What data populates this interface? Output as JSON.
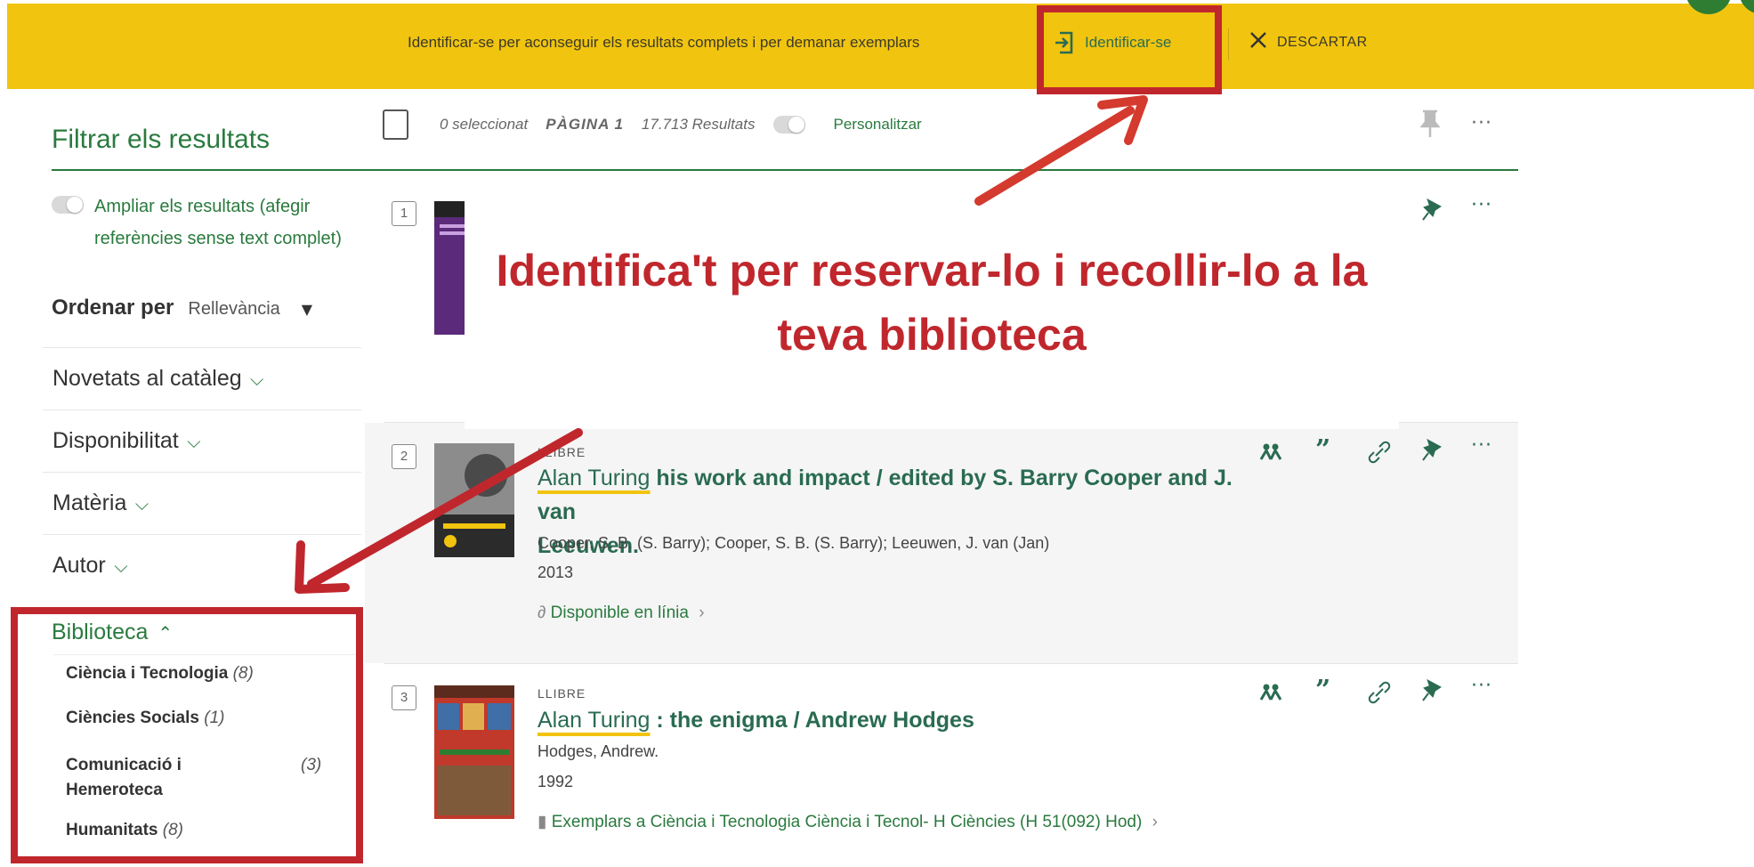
{
  "banner": {
    "message": "Identificar-se per aconseguir els resultats complets i per demanar exemplars",
    "login_label": "Identificar-se",
    "dismiss_label": "DESCARTAR",
    "background_color": "#f1c40f"
  },
  "sidebar": {
    "title": "Filtrar els resultats",
    "expand_label": "Ampliar els resultats (afegir referències sense text complet)",
    "sort_label": "Ordenar per",
    "sort_value": "Rellevància",
    "facets": [
      {
        "label": "Novetats al catàleg",
        "icon": "chevron-down-icon"
      },
      {
        "label": "Disponibilitat",
        "icon": "chevron-down-icon"
      },
      {
        "label": "Matèria",
        "icon": "chevron-down-icon"
      },
      {
        "label": "Autor",
        "icon": "chevron-down-icon"
      }
    ],
    "library": {
      "label": "Biblioteca",
      "icon": "chevron-up-icon",
      "items": [
        {
          "label": "Ciència i Tecnologia",
          "count": "(8)"
        },
        {
          "label": "Ciències Socials",
          "count": "(1)"
        },
        {
          "label": "Comunicació i",
          "label2": "Hemeroteca",
          "count": "(3)"
        },
        {
          "label": "Humanitats",
          "count": "(8)"
        }
      ]
    }
  },
  "results_header": {
    "selected": "0 seleccionat",
    "page": "PÀGINA 1",
    "count": "17.713 Resultats",
    "personalize": "Personalitzar"
  },
  "results": [
    {
      "number": "1"
    },
    {
      "number": "2",
      "type": "LLIBRE",
      "title_highlight": "Alan Turing",
      "title_line1": " his work and impact / edited by S. Barry Cooper and J. van",
      "title_line2": "Leeuwen.",
      "authors": "Cooper, S. B. (S. Barry); Cooper, S. B. (S. Barry); Leeuwen, J. van (Jan)",
      "year": "2013",
      "availability": "Disponible en línia",
      "availability_icon": "link-icon"
    },
    {
      "number": "3",
      "type": "LLIBRE",
      "title_highlight": "Alan Turing",
      "title_line1": " : the enigma / Andrew Hodges",
      "authors": "Hodges, Andrew.",
      "year": "1992",
      "availability": "Exemplars a Ciència i Tecnologia  Ciència i Tecnol- H Ciències (H 51(092) Hod)",
      "availability_icon": "book-icon"
    }
  ],
  "overlay": {
    "line1": "Identifica't per reservar-lo i recollir-lo a la",
    "line2": "teva biblioteca",
    "color": "#c0272d"
  },
  "colors": {
    "accent_green": "#2a7a3e",
    "link_green": "#2a6b52",
    "highlight_red": "#c0272d"
  }
}
